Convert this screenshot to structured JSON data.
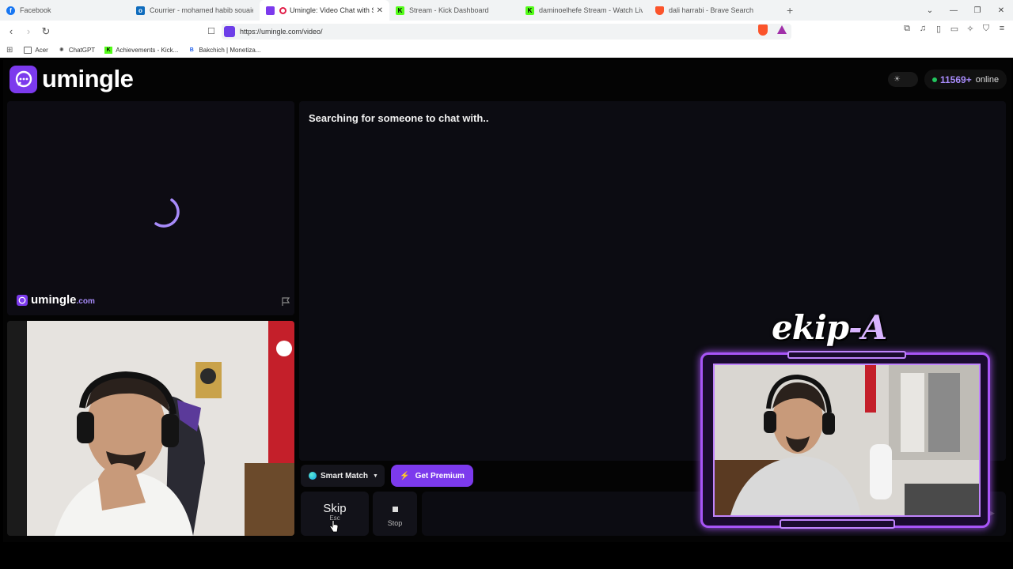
{
  "browser": {
    "tabs": [
      {
        "title": "Facebook",
        "color": "#1877f2",
        "glyph": "f"
      },
      {
        "title": "Courrier - mohamed habib souaied -",
        "color": "#0f6cbd",
        "glyph": "o"
      },
      {
        "title": "Umingle: Video Chat with Stra",
        "color": "#7c3aed",
        "glyph": "",
        "active": true
      },
      {
        "title": "Stream - Kick Dashboard",
        "color": "#53fc18",
        "glyph": "K"
      },
      {
        "title": "daminoelhefe Stream - Watch Live o",
        "color": "#53fc18",
        "glyph": "K"
      },
      {
        "title": "dali harrabi - Brave Search",
        "color": "#fb542b",
        "glyph": ""
      }
    ],
    "url": "https://umingle.com/video/",
    "bookmarks": [
      "Acer",
      "ChatGPT",
      "Achievements - Kick...",
      "Bakchich | Monetiza..."
    ]
  },
  "site": {
    "logo_text": "umingle",
    "online_count": "11569+",
    "online_label": "online",
    "searching_text": "Searching for someone to chat with..",
    "watermark_text": "umingle",
    "watermark_suffix": ".com",
    "smart_match_label": "Smart Match",
    "premium_label": "Get Premium",
    "skip_label": "Skip",
    "skip_key": "Esc",
    "stop_label": "Stop",
    "accent_color": "#7c3aed",
    "online_dot_color": "#22c55e"
  },
  "overlay": {
    "title_main": "ekip",
    "title_accent": "-A"
  }
}
